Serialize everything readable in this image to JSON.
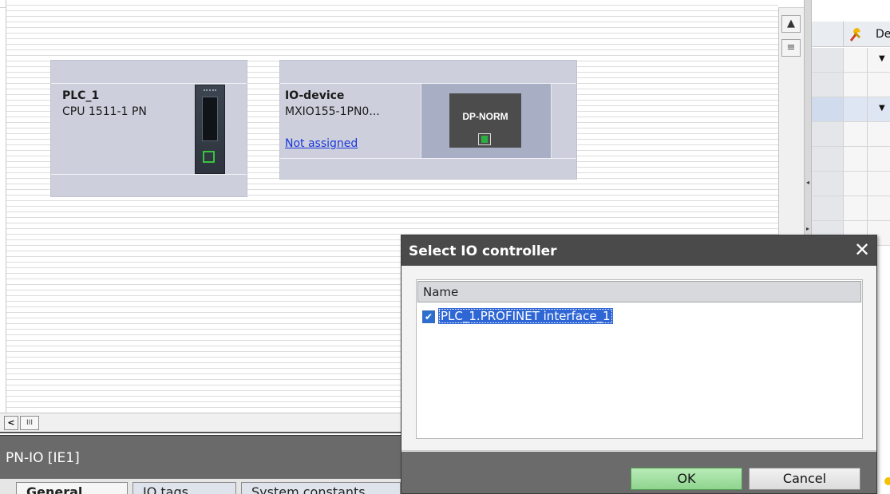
{
  "network_view": {
    "plc": {
      "name": "PLC_1",
      "type": "CPU 1511-1 PN"
    },
    "io_device": {
      "name": "IO-device",
      "type": "MXIO155-1PN0...",
      "assignment_link": "Not assigned",
      "module_label": "DP-NORM"
    }
  },
  "side_panel": {
    "header_text": "De",
    "icon": "tools-icon"
  },
  "inspector": {
    "title": "PN-IO [IE1]",
    "tabs": [
      {
        "label": "General"
      },
      {
        "label": "IO tags"
      },
      {
        "label": "System constants"
      }
    ]
  },
  "dialog": {
    "title": "Select IO controller",
    "list_header": "Name",
    "items": [
      {
        "label": "PLC_1.PROFINET interface_1",
        "checked": true
      }
    ],
    "ok_label": "OK",
    "cancel_label": "Cancel"
  },
  "icons": {
    "scroll_up": "▲",
    "scroll_menu": "≡",
    "scroll_left": "<",
    "scroll_thumb": "III",
    "close": "✕",
    "checkmark": "✔",
    "dropdown": "▼"
  },
  "colors": {
    "device_box": "#cdd0dc",
    "dialog_titlebar": "#4a4a4a",
    "selection": "#2f66d6",
    "ok_button": "#8fd48f",
    "link": "#1a35d9",
    "port_green": "#39c33e"
  }
}
